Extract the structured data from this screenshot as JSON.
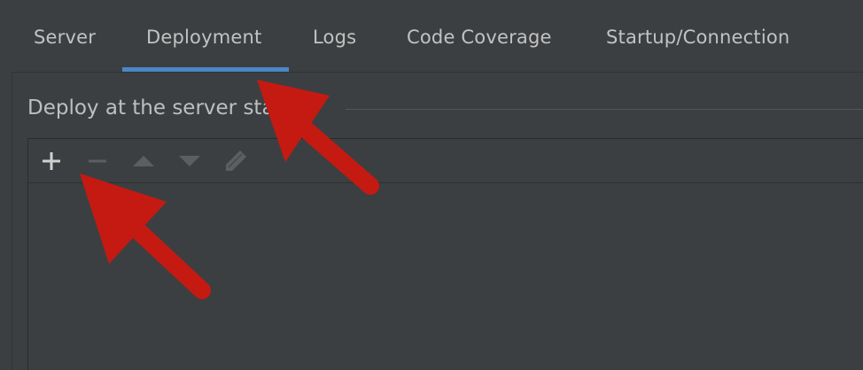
{
  "tabs": [
    {
      "label": "Server"
    },
    {
      "label": "Deployment",
      "selected": true
    },
    {
      "label": "Logs"
    },
    {
      "label": "Code Coverage"
    },
    {
      "label": "Startup/Connection"
    }
  ],
  "deploy_group": {
    "title": "Deploy at the server startup"
  },
  "toolbar": {
    "add_icon": "plus-icon",
    "remove_icon": "minus-icon",
    "up_icon": "move-up-icon",
    "down_icon": "move-down-icon",
    "edit_icon": "pencil-icon",
    "add_enabled": true,
    "remove_enabled": false,
    "up_enabled": false,
    "down_enabled": false,
    "edit_enabled": false
  },
  "colors": {
    "background": "#3c3f41",
    "selected_tab_underline": "#4a88c7",
    "annotation_arrow": "#c41a12"
  }
}
